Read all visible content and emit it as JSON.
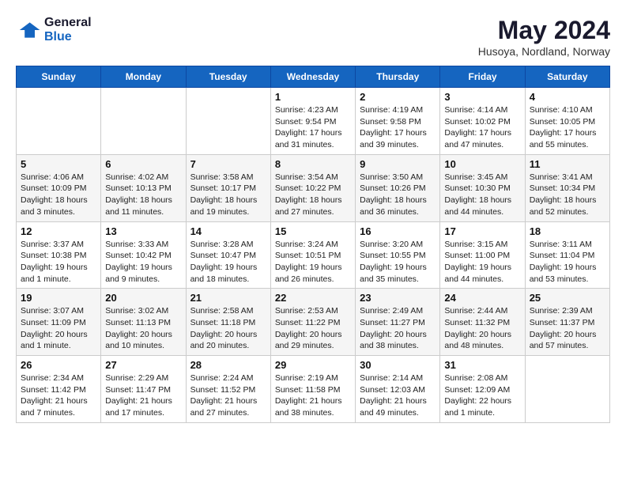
{
  "logo": {
    "line1": "General",
    "line2": "Blue"
  },
  "title": "May 2024",
  "location": "Husoya, Nordland, Norway",
  "days_of_week": [
    "Sunday",
    "Monday",
    "Tuesday",
    "Wednesday",
    "Thursday",
    "Friday",
    "Saturday"
  ],
  "weeks": [
    [
      {
        "date": "",
        "info": ""
      },
      {
        "date": "",
        "info": ""
      },
      {
        "date": "",
        "info": ""
      },
      {
        "date": "1",
        "info": "Sunrise: 4:23 AM\nSunset: 9:54 PM\nDaylight: 17 hours\nand 31 minutes."
      },
      {
        "date": "2",
        "info": "Sunrise: 4:19 AM\nSunset: 9:58 PM\nDaylight: 17 hours\nand 39 minutes."
      },
      {
        "date": "3",
        "info": "Sunrise: 4:14 AM\nSunset: 10:02 PM\nDaylight: 17 hours\nand 47 minutes."
      },
      {
        "date": "4",
        "info": "Sunrise: 4:10 AM\nSunset: 10:05 PM\nDaylight: 17 hours\nand 55 minutes."
      }
    ],
    [
      {
        "date": "5",
        "info": "Sunrise: 4:06 AM\nSunset: 10:09 PM\nDaylight: 18 hours\nand 3 minutes."
      },
      {
        "date": "6",
        "info": "Sunrise: 4:02 AM\nSunset: 10:13 PM\nDaylight: 18 hours\nand 11 minutes."
      },
      {
        "date": "7",
        "info": "Sunrise: 3:58 AM\nSunset: 10:17 PM\nDaylight: 18 hours\nand 19 minutes."
      },
      {
        "date": "8",
        "info": "Sunrise: 3:54 AM\nSunset: 10:22 PM\nDaylight: 18 hours\nand 27 minutes."
      },
      {
        "date": "9",
        "info": "Sunrise: 3:50 AM\nSunset: 10:26 PM\nDaylight: 18 hours\nand 36 minutes."
      },
      {
        "date": "10",
        "info": "Sunrise: 3:45 AM\nSunset: 10:30 PM\nDaylight: 18 hours\nand 44 minutes."
      },
      {
        "date": "11",
        "info": "Sunrise: 3:41 AM\nSunset: 10:34 PM\nDaylight: 18 hours\nand 52 minutes."
      }
    ],
    [
      {
        "date": "12",
        "info": "Sunrise: 3:37 AM\nSunset: 10:38 PM\nDaylight: 19 hours\nand 1 minute."
      },
      {
        "date": "13",
        "info": "Sunrise: 3:33 AM\nSunset: 10:42 PM\nDaylight: 19 hours\nand 9 minutes."
      },
      {
        "date": "14",
        "info": "Sunrise: 3:28 AM\nSunset: 10:47 PM\nDaylight: 19 hours\nand 18 minutes."
      },
      {
        "date": "15",
        "info": "Sunrise: 3:24 AM\nSunset: 10:51 PM\nDaylight: 19 hours\nand 26 minutes."
      },
      {
        "date": "16",
        "info": "Sunrise: 3:20 AM\nSunset: 10:55 PM\nDaylight: 19 hours\nand 35 minutes."
      },
      {
        "date": "17",
        "info": "Sunrise: 3:15 AM\nSunset: 11:00 PM\nDaylight: 19 hours\nand 44 minutes."
      },
      {
        "date": "18",
        "info": "Sunrise: 3:11 AM\nSunset: 11:04 PM\nDaylight: 19 hours\nand 53 minutes."
      }
    ],
    [
      {
        "date": "19",
        "info": "Sunrise: 3:07 AM\nSunset: 11:09 PM\nDaylight: 20 hours\nand 1 minute."
      },
      {
        "date": "20",
        "info": "Sunrise: 3:02 AM\nSunset: 11:13 PM\nDaylight: 20 hours\nand 10 minutes."
      },
      {
        "date": "21",
        "info": "Sunrise: 2:58 AM\nSunset: 11:18 PM\nDaylight: 20 hours\nand 20 minutes."
      },
      {
        "date": "22",
        "info": "Sunrise: 2:53 AM\nSunset: 11:22 PM\nDaylight: 20 hours\nand 29 minutes."
      },
      {
        "date": "23",
        "info": "Sunrise: 2:49 AM\nSunset: 11:27 PM\nDaylight: 20 hours\nand 38 minutes."
      },
      {
        "date": "24",
        "info": "Sunrise: 2:44 AM\nSunset: 11:32 PM\nDaylight: 20 hours\nand 48 minutes."
      },
      {
        "date": "25",
        "info": "Sunrise: 2:39 AM\nSunset: 11:37 PM\nDaylight: 20 hours\nand 57 minutes."
      }
    ],
    [
      {
        "date": "26",
        "info": "Sunrise: 2:34 AM\nSunset: 11:42 PM\nDaylight: 21 hours\nand 7 minutes."
      },
      {
        "date": "27",
        "info": "Sunrise: 2:29 AM\nSunset: 11:47 PM\nDaylight: 21 hours\nand 17 minutes."
      },
      {
        "date": "28",
        "info": "Sunrise: 2:24 AM\nSunset: 11:52 PM\nDaylight: 21 hours\nand 27 minutes."
      },
      {
        "date": "29",
        "info": "Sunrise: 2:19 AM\nSunset: 11:58 PM\nDaylight: 21 hours\nand 38 minutes."
      },
      {
        "date": "30",
        "info": "Sunrise: 2:14 AM\nSunset: 12:03 AM\nDaylight: 21 hours\nand 49 minutes."
      },
      {
        "date": "31",
        "info": "Sunrise: 2:08 AM\nSunset: 12:09 AM\nDaylight: 22 hours\nand 1 minute."
      },
      {
        "date": "",
        "info": ""
      }
    ]
  ]
}
